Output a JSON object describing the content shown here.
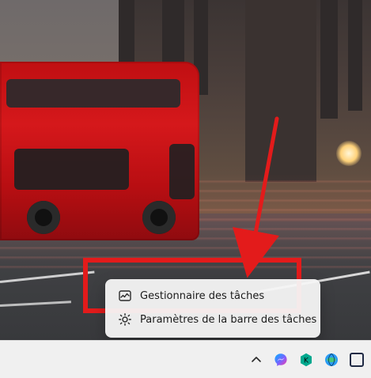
{
  "context_menu": {
    "items": [
      {
        "label": "Gestionnaire des tâches",
        "icon": "task-manager-icon"
      },
      {
        "label": "Paramètres de la barre des tâches",
        "icon": "settings-gear-icon"
      }
    ]
  },
  "annotations": {
    "highlight_color": "#e31b1b"
  },
  "taskbar": {
    "tray_icons": [
      "chevron-up-icon",
      "messenger-icon",
      "kaspersky-icon",
      "network-globe-icon",
      "square-app-icon"
    ]
  }
}
